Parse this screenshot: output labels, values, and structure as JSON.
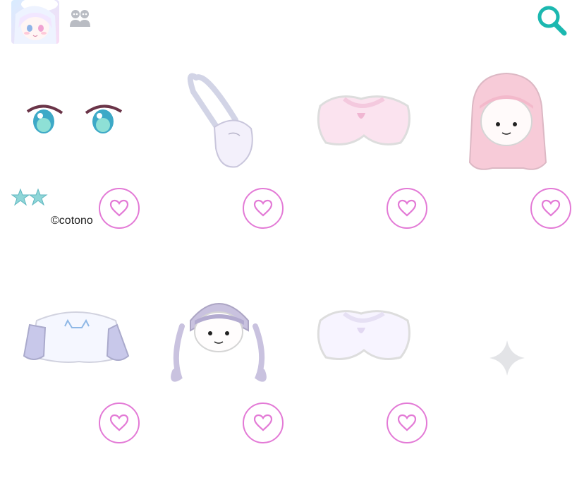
{
  "header": {
    "avatar_icon": "user-avatar",
    "friends_icon": "two-people-icon",
    "search_icon": "search-icon"
  },
  "items": [
    {
      "name": "eyes",
      "credit": "©cotono",
      "rarity_stars": 2,
      "favorite": false
    },
    {
      "name": "shoulder-bag",
      "favorite": false
    },
    {
      "name": "pink-shorts",
      "favorite": false
    },
    {
      "name": "pink-long-hair",
      "favorite": false
    },
    {
      "name": "cat-sweater",
      "favorite": false
    },
    {
      "name": "lavender-twintail-hair",
      "favorite": false
    },
    {
      "name": "white-shorts",
      "favorite": false
    },
    {
      "name": "empty-slot",
      "icon": "sparkle-icon"
    }
  ],
  "colors": {
    "accent_teal": "#1cb8b0",
    "heart_pink": "#e37ad6",
    "muted_icon": "#b9bcc3"
  }
}
